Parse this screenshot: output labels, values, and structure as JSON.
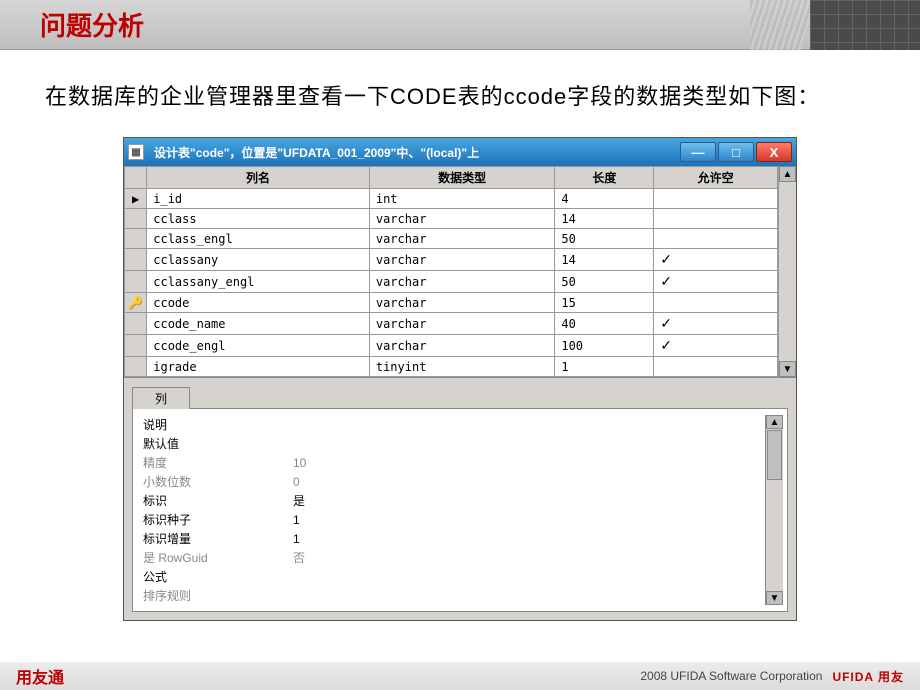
{
  "slide_title": "问题分析",
  "description": "在数据库的企业管理器里查看一下CODE表的ccode字段的数据类型如下图：",
  "window": {
    "title_text": "设计表\"code\"，位置是\"UFDATA_001_2009\"中、\"(local)\"上",
    "buttons": {
      "min": "—",
      "max": "□",
      "close": "X"
    },
    "columns": {
      "name": "列名",
      "type": "数据类型",
      "len": "长度",
      "null": "允许空"
    },
    "rows": [
      {
        "marker": "▶",
        "name": "i_id",
        "type": "int",
        "len": "4",
        "nullable": false
      },
      {
        "marker": "",
        "name": "cclass",
        "type": "varchar",
        "len": "14",
        "nullable": false
      },
      {
        "marker": "",
        "name": "cclass_engl",
        "type": "varchar",
        "len": "50",
        "nullable": false
      },
      {
        "marker": "",
        "name": "cclassany",
        "type": "varchar",
        "len": "14",
        "nullable": true
      },
      {
        "marker": "",
        "name": "cclassany_engl",
        "type": "varchar",
        "len": "50",
        "nullable": true
      },
      {
        "marker": "🔑",
        "name": "ccode",
        "type": "varchar",
        "len": "15",
        "nullable": false
      },
      {
        "marker": "",
        "name": "ccode_name",
        "type": "varchar",
        "len": "40",
        "nullable": true
      },
      {
        "marker": "",
        "name": "ccode_engl",
        "type": "varchar",
        "len": "100",
        "nullable": true
      },
      {
        "marker": "",
        "name": "igrade",
        "type": "tinyint",
        "len": "1",
        "nullable": false
      }
    ]
  },
  "props_tab_label": "列",
  "props": [
    {
      "label": "说明",
      "value": "",
      "grey": false
    },
    {
      "label": "默认值",
      "value": "",
      "grey": false
    },
    {
      "label": "精度",
      "value": "10",
      "grey": true
    },
    {
      "label": "小数位数",
      "value": "0",
      "grey": true
    },
    {
      "label": "标识",
      "value": "是",
      "grey": false
    },
    {
      "label": "标识种子",
      "value": "1",
      "grey": false
    },
    {
      "label": "标识增量",
      "value": "1",
      "grey": false
    },
    {
      "label": "是 RowGuid",
      "value": "否",
      "grey": true
    },
    {
      "label": "公式",
      "value": "",
      "grey": false
    },
    {
      "label": "排序规则",
      "value": "",
      "grey": true
    }
  ],
  "footer": {
    "left_logo": "用友通",
    "right_text": "2008 UFIDA Software Corporation",
    "right_brand": "UFIDA 用友"
  }
}
